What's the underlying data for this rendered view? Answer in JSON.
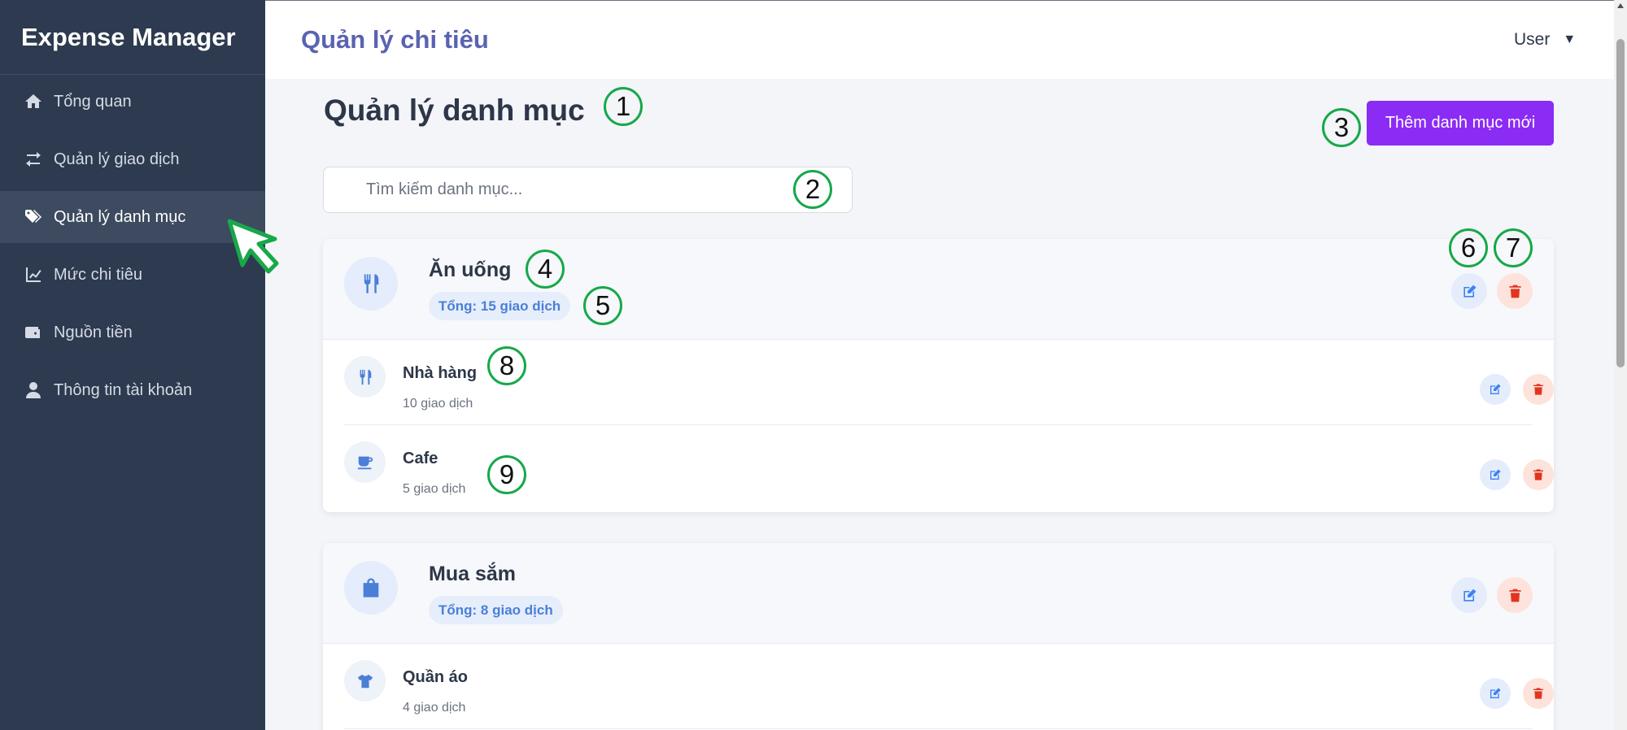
{
  "sidebar": {
    "brand": "Expense Manager",
    "items": [
      {
        "label": "Tổng quan",
        "icon": "home-icon",
        "active": false
      },
      {
        "label": "Quản lý giao dịch",
        "icon": "exchange-icon",
        "active": false
      },
      {
        "label": "Quản lý danh mục",
        "icon": "tags-icon",
        "active": true
      },
      {
        "label": "Mức chi tiêu",
        "icon": "chart-line-icon",
        "active": false
      },
      {
        "label": "Nguồn tiền",
        "icon": "wallet-icon",
        "active": false
      },
      {
        "label": "Thông tin tài khoản",
        "icon": "user-icon",
        "active": false
      }
    ]
  },
  "header": {
    "title": "Quản lý chi tiêu",
    "user_label": "User",
    "caret": "▼"
  },
  "main": {
    "page_title": "Quản lý danh mục",
    "add_button": "Thêm danh mục mới",
    "search_placeholder": "Tìm kiếm danh mục...",
    "categories": [
      {
        "name": "Ăn uống",
        "icon": "utensils-icon",
        "total": "Tổng: 15 giao dịch",
        "subs": [
          {
            "name": "Nhà hàng",
            "count": "10 giao dịch",
            "icon": "utensils-icon"
          },
          {
            "name": "Cafe",
            "count": "5 giao dịch",
            "icon": "coffee-icon"
          }
        ]
      },
      {
        "name": "Mua sắm",
        "icon": "shopping-bag-icon",
        "total": "Tổng: 8 giao dịch",
        "subs": [
          {
            "name": "Quần áo",
            "count": "4 giao dịch",
            "icon": "tshirt-icon"
          }
        ]
      }
    ]
  },
  "annotations": [
    "1",
    "2",
    "3",
    "4",
    "5",
    "6",
    "7",
    "8",
    "9"
  ],
  "colors": {
    "sidebar_bg": "#2d3a4f",
    "accent_purple": "#8b2cf5",
    "title_blue": "#5a63b1",
    "icon_blue": "#4a7fd8",
    "delete_red": "#e3341f",
    "marker_green": "#17a84a"
  }
}
